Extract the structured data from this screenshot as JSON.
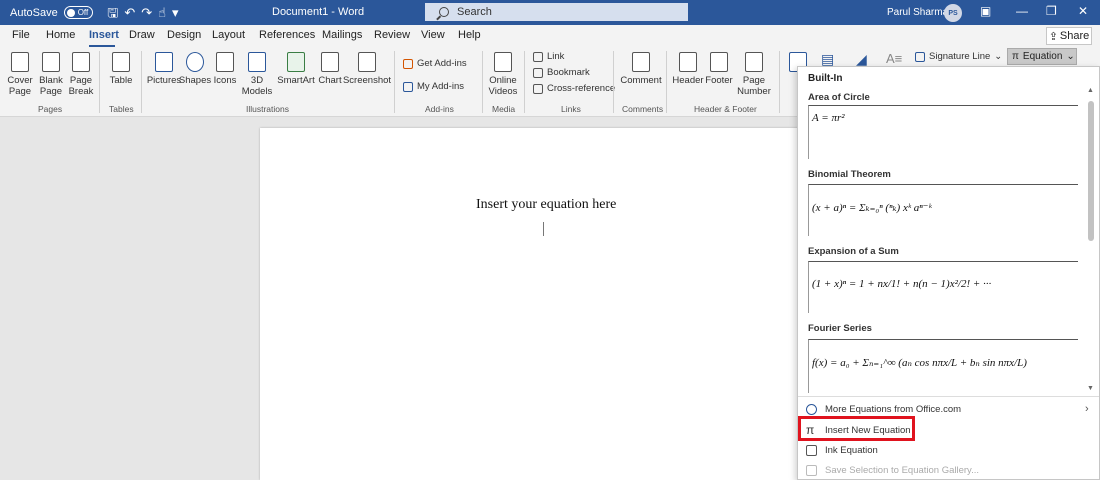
{
  "titlebar": {
    "autosave_label": "AutoSave",
    "autosave_state": "Off",
    "document_title": "Document1 - Word",
    "search_label": "Search",
    "user_name": "Parul Sharma",
    "user_initials": "PS"
  },
  "menu": {
    "tabs": [
      "File",
      "Home",
      "Insert",
      "Draw",
      "Design",
      "Layout",
      "References",
      "Mailings",
      "Review",
      "View",
      "Help"
    ],
    "active": "Insert",
    "share_label": "Share"
  },
  "ribbon": {
    "cover_page": "Cover\nPage",
    "blank_page": "Blank\nPage",
    "page_break": "Page\nBreak",
    "table": "Table",
    "pictures": "Pictures",
    "shapes": "Shapes",
    "icons": "Icons",
    "models_3d": "3D\nModels",
    "smartart": "SmartArt",
    "chart": "Chart",
    "screenshot": "Screenshot",
    "get_addins": "Get Add-ins",
    "my_addins": "My Add-ins",
    "online_videos": "Online\nVideos",
    "link": "Link",
    "bookmark": "Bookmark",
    "cross_reference": "Cross-reference",
    "comment": "Comment",
    "header": "Header",
    "footer": "Footer",
    "page_number": "Page\nNumber",
    "signature_line": "Signature Line",
    "equation": "Equation",
    "groups": {
      "pages": "Pages",
      "tables": "Tables",
      "illustrations": "Illustrations",
      "addins": "Add-ins",
      "media": "Media",
      "links": "Links",
      "comments": "Comments",
      "header_footer": "Header & Footer"
    }
  },
  "document": {
    "text": "Insert your equation here"
  },
  "equation_panel": {
    "heading": "Built-In",
    "equations": [
      {
        "title": "Area of Circle",
        "formula": "A = πr²"
      },
      {
        "title": "Binomial Theorem",
        "formula": "(x + a)ⁿ = Σₖ₌₀ⁿ (ⁿₖ) xᵏ aⁿ⁻ᵏ"
      },
      {
        "title": "Expansion of a Sum",
        "formula": "(1 + x)ⁿ = 1 + nx/1! + n(n − 1)x²/2! + ···"
      },
      {
        "title": "Fourier Series",
        "formula": "f(x) = a₀ + Σₙ₌₁^∞ (aₙ cos nπx/L + bₙ sin nπx/L)"
      }
    ],
    "more_equations": "More Equations from Office.com",
    "insert_new": "Insert New Equation",
    "ink_equation": "Ink Equation",
    "save_selection": "Save Selection to Equation Gallery..."
  }
}
